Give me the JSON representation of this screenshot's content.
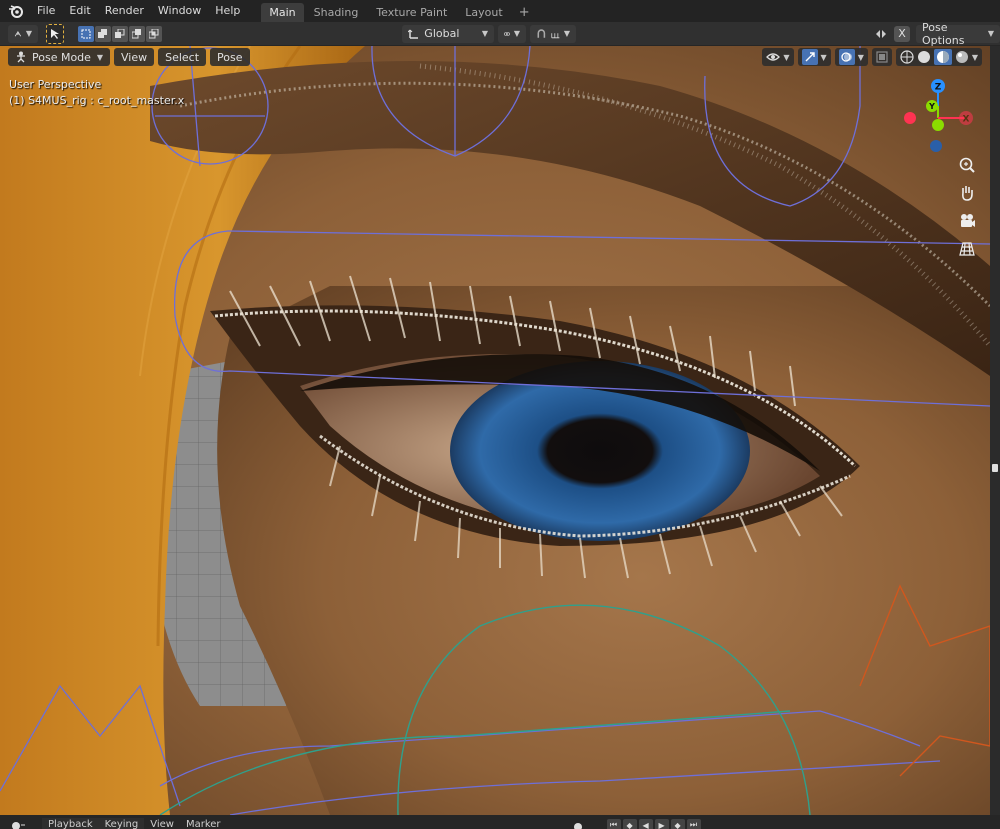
{
  "menu": {
    "items": [
      "File",
      "Edit",
      "Render",
      "Window",
      "Help"
    ]
  },
  "workspaces": {
    "tabs": [
      "Main",
      "Shading",
      "Texture Paint",
      "Layout"
    ],
    "active": "Main"
  },
  "toolbar": {
    "transform_orientation": "Global",
    "pose_options_label": "Pose Options",
    "x_label": "X"
  },
  "viewport": {
    "mode_label": "Pose Mode",
    "header_menus": [
      "View",
      "Select",
      "Pose"
    ],
    "perspective_label": "User Perspective",
    "object_label": "(1) S4MUS_rig : c_root_master.x",
    "gizmo_axes": {
      "x": "X",
      "y": "Y",
      "z": "Z"
    }
  },
  "timeline": {
    "items": [
      "Playback",
      "Keying",
      "View",
      "Marker"
    ]
  },
  "colors": {
    "accent": "#4772b3",
    "axis_x": "#ff3352",
    "axis_y": "#8bdc00",
    "axis_z": "#2890ff"
  }
}
